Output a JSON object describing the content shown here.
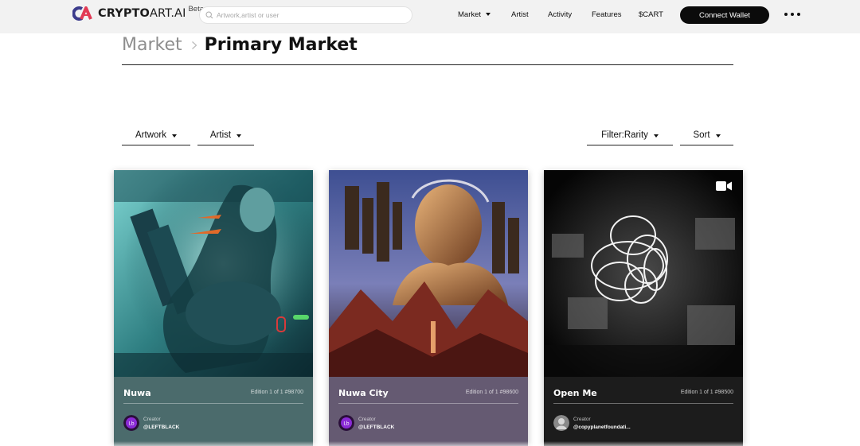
{
  "brand": {
    "name_bold": "CRYPTO",
    "name_thin": "ART.AI",
    "beta": "Beta"
  },
  "search": {
    "placeholder": "Artwork,artist or user"
  },
  "nav": {
    "market": "Market",
    "artist": "Artist",
    "activity": "Activity",
    "features": "Features",
    "cart": "$CART",
    "connect": "Connect Wallet"
  },
  "breadcrumb": {
    "parent": "Market",
    "current": "Primary Market"
  },
  "filters": {
    "artwork": "Artwork",
    "artist": "Artist",
    "rarity": "Filter:Rarity",
    "sort": "Sort"
  },
  "cards": [
    {
      "title": "Nuwa",
      "edition": "Edition 1 of 1 #98700",
      "creator_label": "Creator",
      "creator": "@LEFTBLACK",
      "info_color": "#4b6b6c"
    },
    {
      "title": "Nuwa City",
      "edition": "Edition 1 of 1 #98600",
      "creator_label": "Creator",
      "creator": "@LEFTBLACK",
      "info_color": "#655a72"
    },
    {
      "title": "Open Me",
      "edition": "Edition 1 of 1 #98500",
      "creator_label": "Creator",
      "creator": "@copyplanetfoundati...",
      "info_color": "#1c1c1c"
    }
  ],
  "icons": {
    "logo": "cryptoart-logo",
    "search": "search-icon",
    "more": "more-dots-icon",
    "video": "video-camera-icon"
  }
}
